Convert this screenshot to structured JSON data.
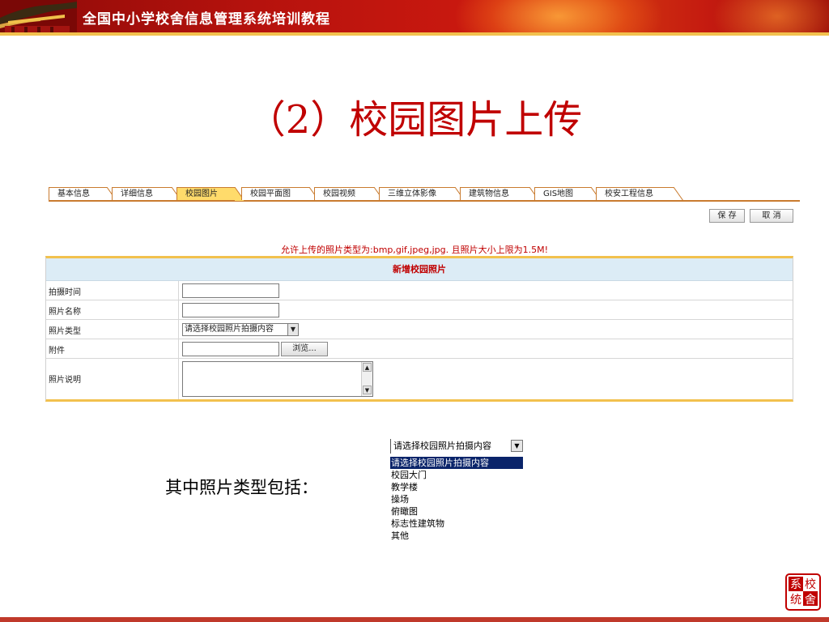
{
  "header": {
    "title": "全国中小学校舍信息管理系统培训教程"
  },
  "slide_title": "（2）校园图片上传",
  "tabs": [
    {
      "label": "基本信息",
      "active": false
    },
    {
      "label": "详细信息",
      "active": false
    },
    {
      "label": "校园图片",
      "active": true
    },
    {
      "label": "校园平面图",
      "active": false
    },
    {
      "label": "校园视频",
      "active": false
    },
    {
      "label": "三维立体影像",
      "active": false
    },
    {
      "label": "建筑物信息",
      "active": false
    },
    {
      "label": "GIS地图",
      "active": false
    },
    {
      "label": "校安工程信息",
      "active": false
    }
  ],
  "buttons": {
    "save": "保 存",
    "cancel": "取 消"
  },
  "notice": "允许上传的照片类型为:bmp,gif,jpeg,jpg. 且照片大小上限为1.5M!",
  "form": {
    "title": "新增校园照片",
    "fields": {
      "time": {
        "label": "拍摄时间",
        "value": ""
      },
      "name": {
        "label": "照片名称",
        "value": ""
      },
      "type": {
        "label": "照片类型",
        "value": "请选择校园照片拍摄内容"
      },
      "attachment": {
        "label": "附件",
        "value": "",
        "browse": "浏览..."
      },
      "desc": {
        "label": "照片说明",
        "value": ""
      }
    }
  },
  "caption": "其中照片类型包括：",
  "photo_types": {
    "closed_value": "请选择校园照片拍摄内容",
    "options": [
      "请选择校园照片拍摄内容",
      "校园大门",
      "教学楼",
      "操场",
      "俯瞰图",
      "标志性建筑物",
      "其他"
    ],
    "selected_index": 0
  },
  "logo": {
    "text": "系统校舍"
  },
  "colors": {
    "brand_red": "#c00000",
    "tab_active": "#ffdb6b",
    "tab_border": "#c97b2f",
    "form_accent": "#f2c14e",
    "form_head_bg": "#dcecf6"
  }
}
